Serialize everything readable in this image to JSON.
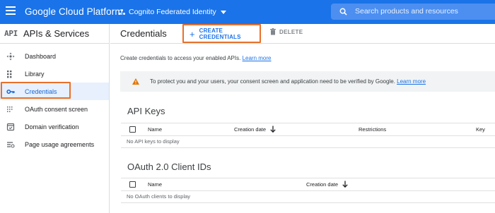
{
  "topbar": {
    "product_name": "Google Cloud Platform",
    "project_name": "Cognito Federated Identity",
    "search_placeholder": "Search products and resources",
    "accent_color": "#1a73e8"
  },
  "sidebar": {
    "logo": "API",
    "title": "APIs & Services",
    "items": [
      {
        "label": "Dashboard",
        "icon": "dashboard-icon",
        "active": false
      },
      {
        "label": "Library",
        "icon": "library-icon",
        "active": false
      },
      {
        "label": "Credentials",
        "icon": "key-icon",
        "active": true
      },
      {
        "label": "OAuth consent screen",
        "icon": "consent-icon",
        "active": false
      },
      {
        "label": "Domain verification",
        "icon": "domain-verification-icon",
        "active": false
      },
      {
        "label": "Page usage agreements",
        "icon": "settings-list-icon",
        "active": false
      }
    ]
  },
  "header": {
    "title": "Credentials",
    "create_label": "CREATE CREDENTIALS",
    "delete_label": "DELETE"
  },
  "content": {
    "intro_text": "Create credentials to access your enabled APIs.",
    "intro_link": "Learn more",
    "banner_text": "To protect you and your users, your consent screen and application need to be verified by Google.",
    "banner_link": "Learn more",
    "api_keys": {
      "title": "API Keys",
      "columns": [
        "Name",
        "Creation date",
        "Restrictions",
        "Key"
      ],
      "empty_text": "No API keys to display"
    },
    "oauth": {
      "title": "OAuth 2.0 Client IDs",
      "columns": [
        "Name",
        "Creation date"
      ],
      "empty_text": "No OAuth clients to display"
    }
  }
}
